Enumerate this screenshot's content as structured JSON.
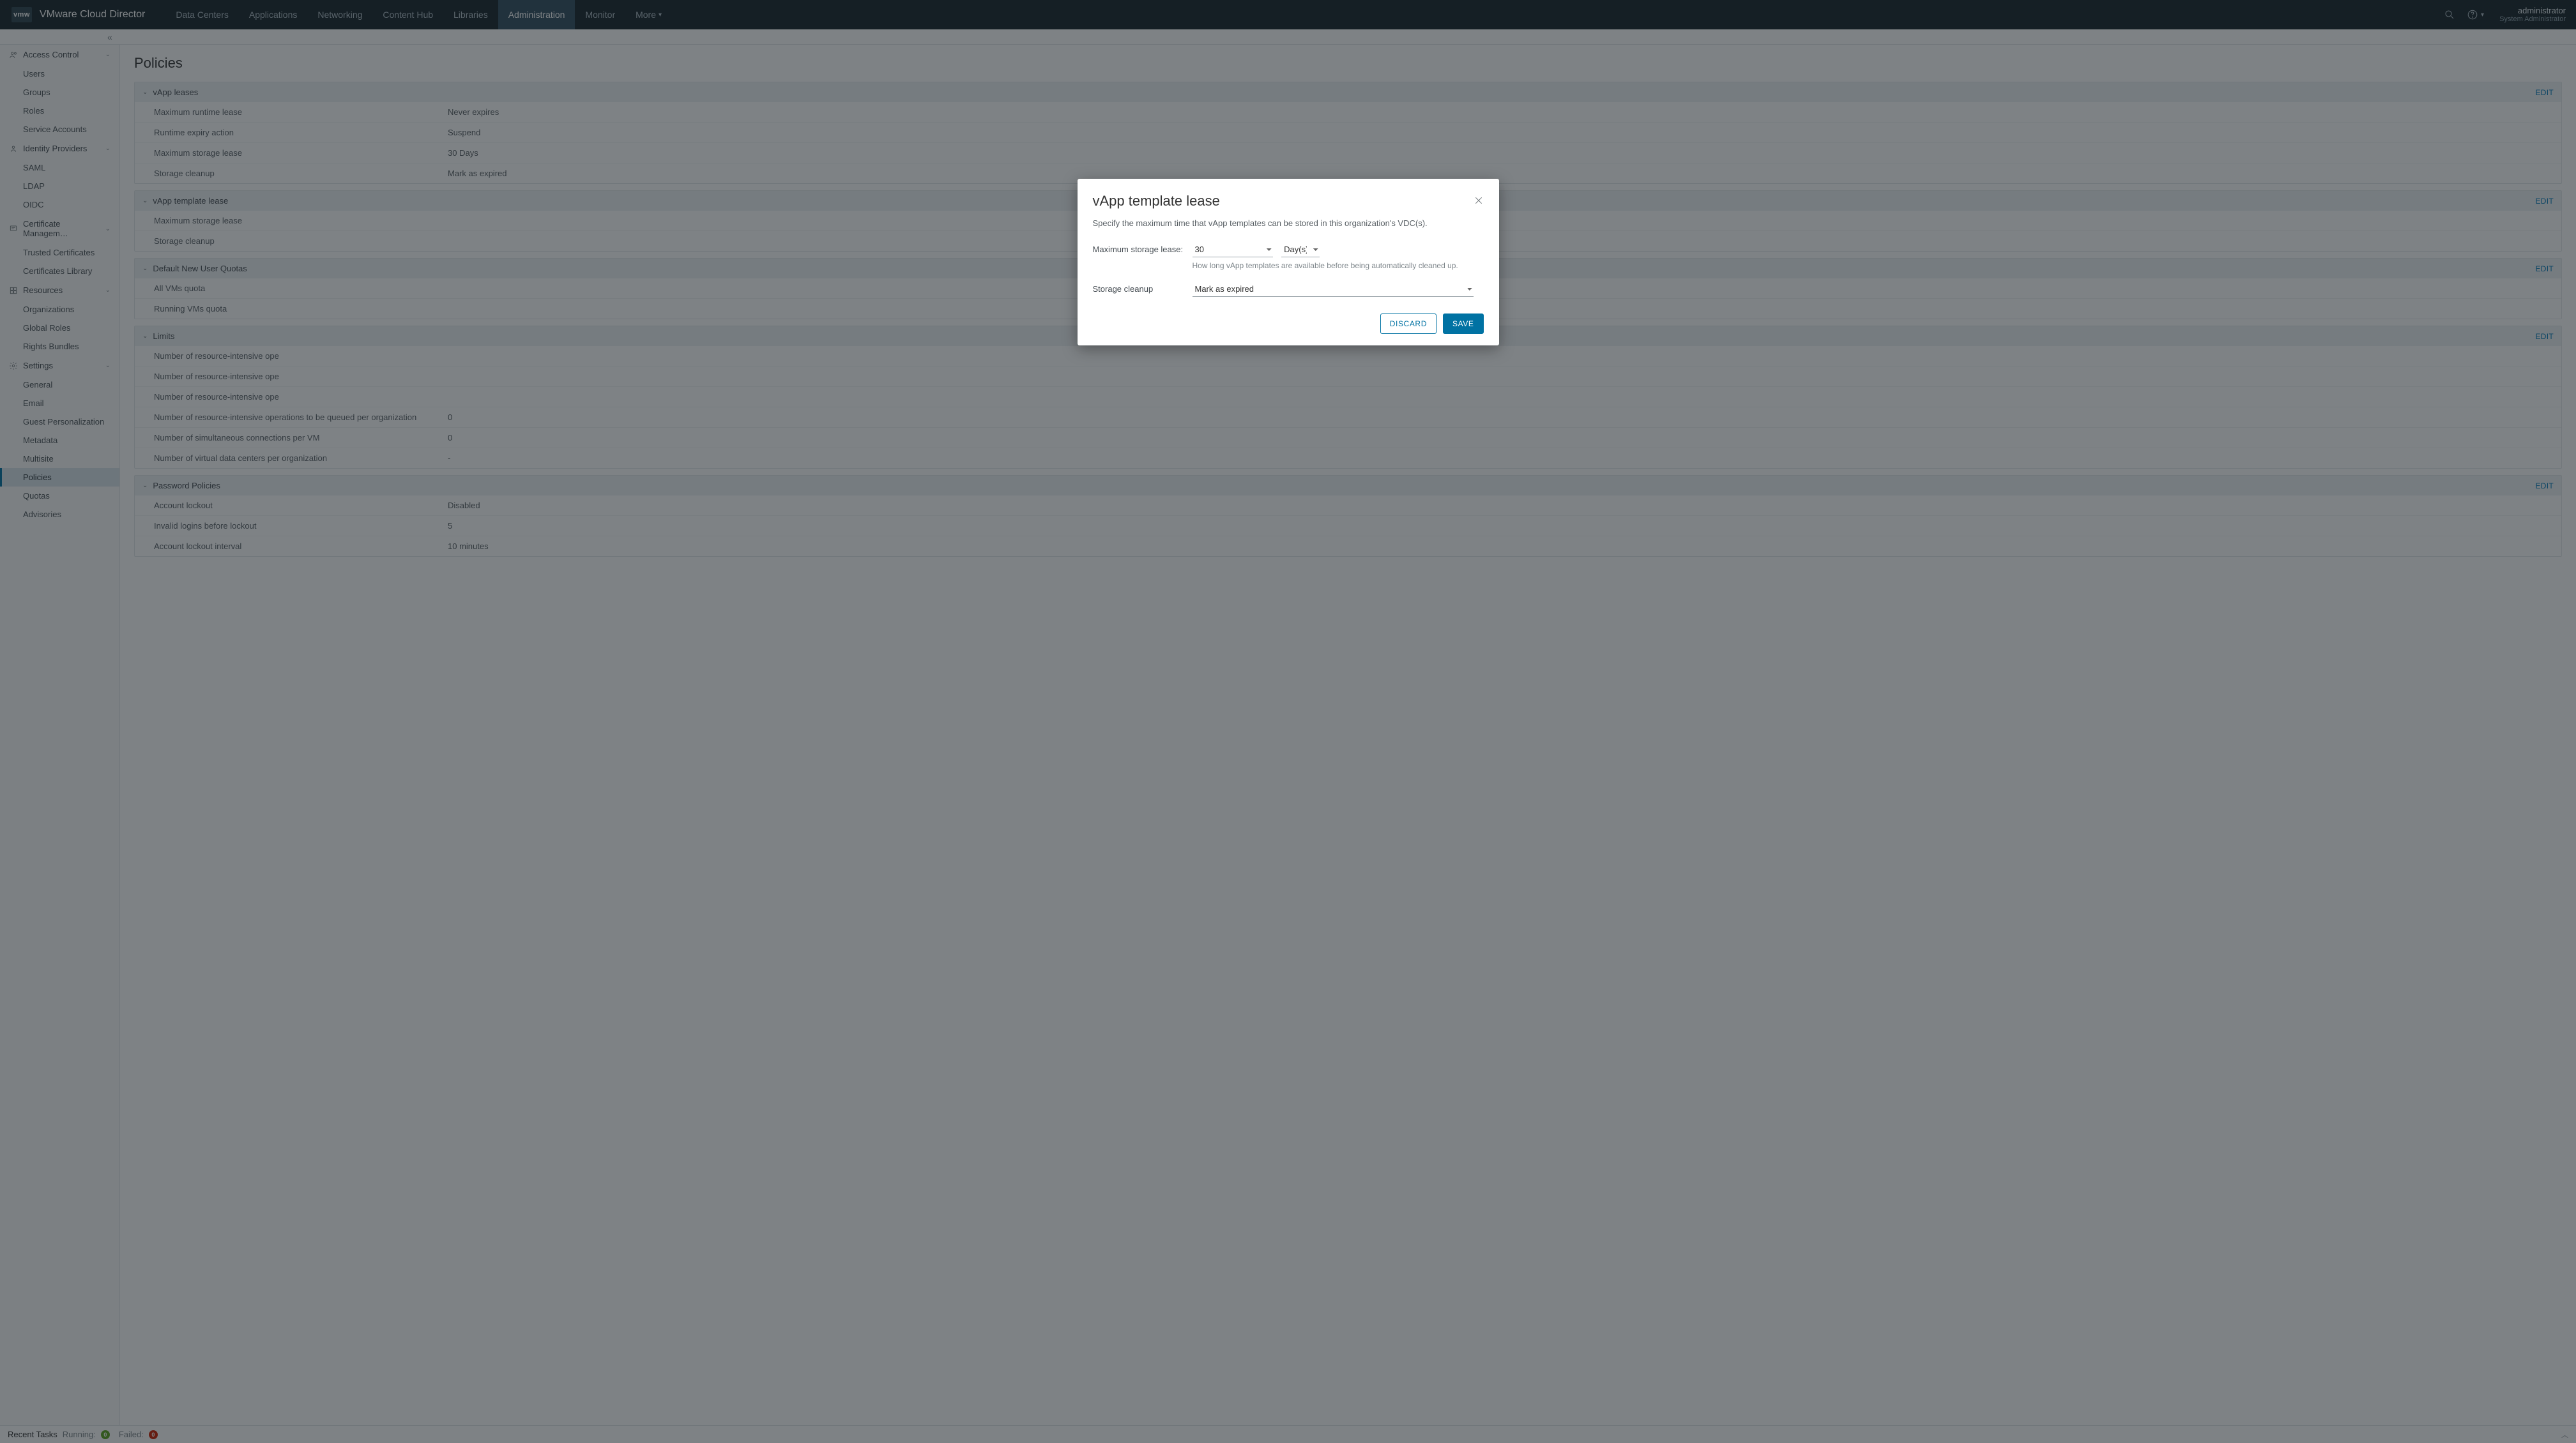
{
  "header": {
    "logo": "vmw",
    "app_title": "VMware Cloud Director",
    "tabs": [
      "Data Centers",
      "Applications",
      "Networking",
      "Content Hub",
      "Libraries",
      "Administration",
      "Monitor",
      "More"
    ],
    "active_tab": 5,
    "user": {
      "name": "administrator",
      "role": "System Administrator"
    }
  },
  "sidebar": {
    "groups": [
      {
        "label": "Access Control",
        "icon": "users",
        "items": [
          "Users",
          "Groups",
          "Roles",
          "Service Accounts"
        ]
      },
      {
        "label": "Identity Providers",
        "icon": "id",
        "items": [
          "SAML",
          "LDAP",
          "OIDC"
        ]
      },
      {
        "label": "Certificate Managem…",
        "icon": "cert",
        "items": [
          "Trusted Certificates",
          "Certificates Library"
        ]
      },
      {
        "label": "Resources",
        "icon": "res",
        "items": [
          "Organizations",
          "Global Roles",
          "Rights Bundles"
        ]
      },
      {
        "label": "Settings",
        "icon": "gear",
        "items": [
          "General",
          "Email",
          "Guest Personalization",
          "Metadata",
          "Multisite",
          "Policies",
          "Quotas",
          "Advisories"
        ],
        "active": "Policies"
      }
    ]
  },
  "page": {
    "title": "Policies",
    "edit_label": "EDIT",
    "sections": [
      {
        "title": "vApp leases",
        "rows": [
          {
            "k": "Maximum runtime lease",
            "v": "Never expires"
          },
          {
            "k": "Runtime expiry action",
            "v": "Suspend"
          },
          {
            "k": "Maximum storage lease",
            "v": "30 Days"
          },
          {
            "k": "Storage cleanup",
            "v": "Mark as expired"
          }
        ]
      },
      {
        "title": "vApp template lease",
        "rows": [
          {
            "k": "Maximum storage lease",
            "v": ""
          },
          {
            "k": "Storage cleanup",
            "v": ""
          }
        ]
      },
      {
        "title": "Default New User Quotas",
        "rows": [
          {
            "k": "All VMs quota",
            "v": ""
          },
          {
            "k": "Running VMs quota",
            "v": ""
          }
        ]
      },
      {
        "title": "Limits",
        "rows": [
          {
            "k": "Number of resource-intensive ope",
            "v": ""
          },
          {
            "k": "Number of resource-intensive ope",
            "v": ""
          },
          {
            "k": "Number of resource-intensive ope",
            "v": ""
          },
          {
            "k": "Number of resource-intensive operations to be queued per organization",
            "v": "0"
          },
          {
            "k": "Number of simultaneous connections per VM",
            "v": "0"
          },
          {
            "k": "Number of virtual data centers per organization",
            "v": "-"
          }
        ]
      },
      {
        "title": "Password Policies",
        "rows": [
          {
            "k": "Account lockout",
            "v": "Disabled"
          },
          {
            "k": "Invalid logins before lockout",
            "v": "5"
          },
          {
            "k": "Account lockout interval",
            "v": "10 minutes"
          }
        ]
      }
    ]
  },
  "tasks": {
    "label": "Recent Tasks",
    "running_label": "Running:",
    "running": "0",
    "failed_label": "Failed:",
    "failed": "0"
  },
  "modal": {
    "title": "vApp template lease",
    "desc": "Specify the maximum time that vApp templates can be stored in this organization's VDC(s).",
    "field1_label": "Maximum storage lease:",
    "field1_value": "30",
    "field1_unit": "Day(s)",
    "field1_hint": "How long vApp templates are available before being automatically cleaned up.",
    "field2_label": "Storage cleanup",
    "field2_value": "Mark as expired",
    "discard": "DISCARD",
    "save": "SAVE"
  }
}
